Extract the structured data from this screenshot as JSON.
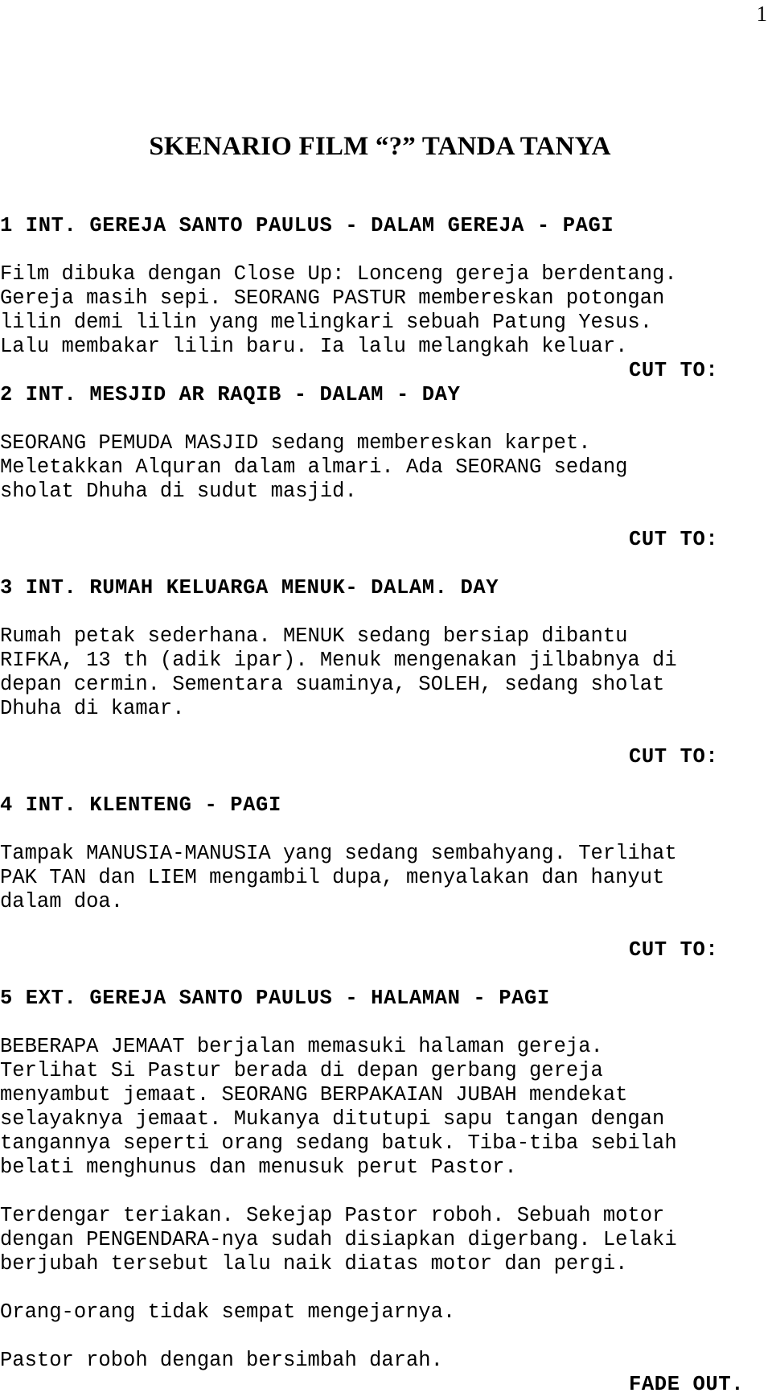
{
  "page": {
    "page_number": "1",
    "title": "SKENARIO FILM “?” TANDA TANYA"
  },
  "script_lines": [
    {
      "type": "blank",
      "text": ""
    },
    {
      "type": "heading",
      "text": "1 INT. GEREJA SANTO PAULUS - DALAM GEREJA - PAGI"
    },
    {
      "type": "blank",
      "text": ""
    },
    {
      "type": "action",
      "text": "Film dibuka dengan Close Up: Lonceng gereja berdentang."
    },
    {
      "type": "action",
      "text": "Gereja masih sepi. SEORANG PASTUR membereskan potongan"
    },
    {
      "type": "action",
      "text": "lilin demi lilin yang melingkari sebuah Patung Yesus."
    },
    {
      "type": "action",
      "text": "Lalu membakar lilin baru. Ia lalu melangkah keluar."
    },
    {
      "type": "transition",
      "text": "CUT TO:"
    },
    {
      "type": "heading",
      "text": "2 INT. MESJID AR RAQIB - DALAM - DAY"
    },
    {
      "type": "blank",
      "text": ""
    },
    {
      "type": "action",
      "text": "SEORANG PEMUDA MASJID sedang membereskan karpet."
    },
    {
      "type": "action",
      "text": "Meletakkan Alquran dalam almari. Ada SEORANG sedang"
    },
    {
      "type": "action",
      "text": "sholat Dhuha di sudut masjid."
    },
    {
      "type": "blank",
      "text": ""
    },
    {
      "type": "transition",
      "text": "CUT TO:"
    },
    {
      "type": "blank",
      "text": ""
    },
    {
      "type": "heading",
      "text": "3 INT. RUMAH KELUARGA MENUK- DALAM. DAY"
    },
    {
      "type": "blank",
      "text": ""
    },
    {
      "type": "action",
      "text": "Rumah petak sederhana. MENUK sedang bersiap dibantu"
    },
    {
      "type": "action",
      "text": "RIFKA, 13 th (adik ipar). Menuk mengenakan jilbabnya di"
    },
    {
      "type": "action",
      "text": "depan cermin. Sementara suaminya, SOLEH, sedang sholat"
    },
    {
      "type": "action",
      "text": "Dhuha di kamar."
    },
    {
      "type": "blank",
      "text": ""
    },
    {
      "type": "transition",
      "text": "CUT TO:"
    },
    {
      "type": "blank",
      "text": ""
    },
    {
      "type": "heading",
      "text": "4 INT. KLENTENG - PAGI"
    },
    {
      "type": "blank",
      "text": ""
    },
    {
      "type": "action",
      "text": "Tampak MANUSIA-MANUSIA yang sedang sembahyang. Terlihat"
    },
    {
      "type": "action",
      "text": "PAK TAN dan LIEM mengambil dupa, menyalakan dan hanyut"
    },
    {
      "type": "action",
      "text": "dalam doa."
    },
    {
      "type": "blank",
      "text": ""
    },
    {
      "type": "transition",
      "text": "CUT TO:"
    },
    {
      "type": "blank",
      "text": ""
    },
    {
      "type": "heading",
      "text": "5 EXT. GEREJA SANTO PAULUS - HALAMAN - PAGI"
    },
    {
      "type": "blank",
      "text": ""
    },
    {
      "type": "action",
      "text": "BEBERAPA JEMAAT berjalan memasuki halaman gereja."
    },
    {
      "type": "action",
      "text": "Terlihat Si Pastur berada di depan gerbang gereja"
    },
    {
      "type": "action",
      "text": "menyambut jemaat. SEORANG BERPAKAIAN JUBAH mendekat"
    },
    {
      "type": "action",
      "text": "selayaknya jemaat. Mukanya ditutupi sapu tangan dengan"
    },
    {
      "type": "action",
      "text": "tangannya seperti orang sedang batuk. Tiba-tiba sebilah"
    },
    {
      "type": "action",
      "text": "belati menghunus dan menusuk perut Pastor."
    },
    {
      "type": "blank",
      "text": ""
    },
    {
      "type": "action",
      "text": "Terdengar teriakan. Sekejap Pastor roboh. Sebuah motor"
    },
    {
      "type": "action",
      "text": "dengan PENGENDARA-nya sudah disiapkan digerbang. Lelaki"
    },
    {
      "type": "action",
      "text": "berjubah tersebut lalu naik diatas motor dan pergi."
    },
    {
      "type": "blank",
      "text": ""
    },
    {
      "type": "action",
      "text": "Orang-orang tidak sempat mengejarnya."
    },
    {
      "type": "blank",
      "text": ""
    },
    {
      "type": "action",
      "text": "Pastor roboh dengan bersimbah darah."
    },
    {
      "type": "transition",
      "text": "FADE OUT."
    }
  ]
}
